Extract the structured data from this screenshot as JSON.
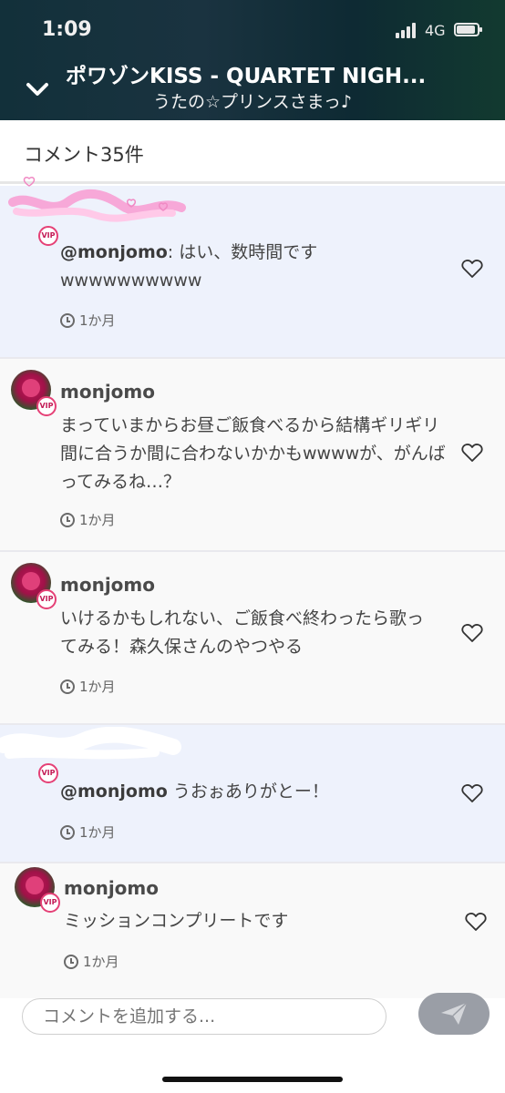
{
  "status_bar": {
    "time": "1:09",
    "network": "4G",
    "battery_level": 0.9
  },
  "header": {
    "title": "ポワゾンKISS  - QUARTET NIGH...",
    "subtitle": "うたの☆プリンスさまっ♪"
  },
  "comment_count": "コメント35件",
  "comments": [
    {
      "type": "reply",
      "username": "",
      "vip_badge": "VIP",
      "mention": "@monjomo",
      "text": ": はい、数時間です",
      "text2": "wwwwwwwwww",
      "time": "1か月"
    },
    {
      "type": "own",
      "username": "monjomo",
      "vip_badge": "VIP",
      "text": "まっていまからお昼ご飯食べるから結構ギリギリ間に合うか間に合わないかかもwwwwが、がんばってみるね…？",
      "time": "1か月"
    },
    {
      "type": "own",
      "username": "monjomo",
      "vip_badge": "VIP",
      "text": "いけるかもしれない、ご飯食べ終わったら歌ってみる！森久保さんのやつやる",
      "time": "1か月"
    },
    {
      "type": "reply",
      "username": "",
      "vip_badge": "VIP",
      "mention": "@monjomo",
      "text": " うおぉありがとー！",
      "time": "1か月"
    },
    {
      "type": "own",
      "username": "monjomo",
      "vip_badge": "VIP",
      "text": "ミッションコンプリートです",
      "time": "1か月"
    }
  ],
  "input": {
    "placeholder": "コメントを追加する..."
  },
  "colors": {
    "header_bg": "#12303a",
    "reply_bg": "#eef2fc",
    "own_bg": "#f9f9f9",
    "vip_accent": "#e54076",
    "send_button": "#9a9ea6"
  },
  "icons": {
    "back": "chevron-down-icon",
    "like": "heart-icon",
    "time": "clock-icon",
    "send": "paper-plane-icon"
  }
}
